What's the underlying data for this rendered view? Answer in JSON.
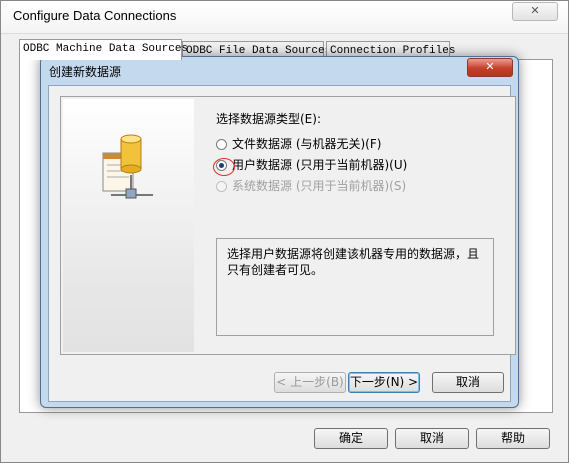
{
  "window": {
    "title": "Configure Data Connections",
    "close_icon": "✕"
  },
  "tabs": [
    {
      "label": "ODBC Machine Data Sources"
    },
    {
      "label": "ODBC File Data Sources"
    },
    {
      "label": "Connection Profiles"
    }
  ],
  "outer_buttons": {
    "ok": "确定",
    "cancel": "取消",
    "help": "帮助"
  },
  "dialog": {
    "title": "创建新数据源",
    "close_icon": "✕",
    "prompt": "选择数据源类型(E):",
    "options": [
      {
        "label": "文件数据源 (与机器无关)(F)",
        "selected": false,
        "enabled": true
      },
      {
        "label": "用户数据源 (只用于当前机器)(U)",
        "selected": true,
        "enabled": true
      },
      {
        "label": "系统数据源 (只用于当前机器)(S)",
        "selected": false,
        "enabled": false
      }
    ],
    "description": "选择用户数据源将创建该机器专用的数据源，且只有创建者可见。",
    "buttons": {
      "back": "< 上一步(B)",
      "next": "下一步(N) >",
      "cancel": "取消"
    }
  },
  "colors": {
    "dialog_frame": "#c5d9ee",
    "close_button": "#c4402a",
    "highlight_ring": "#e03030"
  }
}
